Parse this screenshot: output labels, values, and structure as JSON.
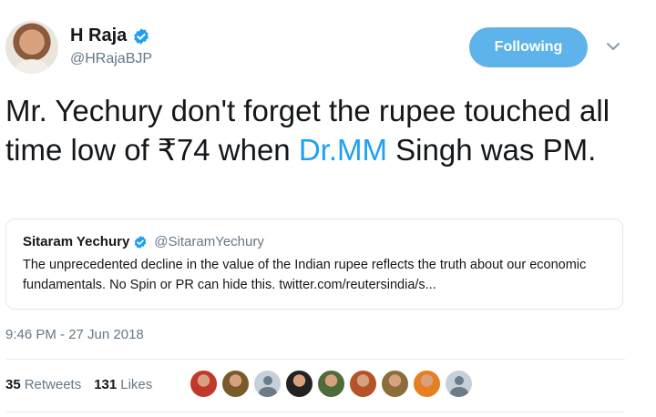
{
  "author": {
    "name": "H Raja",
    "handle": "@HRajaBJP"
  },
  "follow_button": {
    "label": "Following"
  },
  "tweet": {
    "text_before": "Mr. Yechury don't forget the rupee touched all time low of ₹74 when ",
    "mention": "Dr.MM",
    "text_after": " Singh was PM.",
    "timestamp": "9:46 PM - 27 Jun 2018"
  },
  "quoted_tweet": {
    "name": "Sitaram Yechury",
    "handle": "@SitaramYechury",
    "text": "The unprecedented decline in the value of the Indian rupee reflects the truth about our economic fundamentals. No Spin or PR can hide this. twitter.com/reutersindia/s..."
  },
  "stats": {
    "retweets_count": "35",
    "retweets_label": "Retweets",
    "likes_count": "131",
    "likes_label": "Likes"
  },
  "liker_avatars": [
    {
      "color": "#c0392b"
    },
    {
      "color": "#7a5a2a"
    },
    {
      "color": "default"
    },
    {
      "color": "#222222"
    },
    {
      "color": "#4e6b3a"
    },
    {
      "color": "#b5532a"
    },
    {
      "color": "#8a6d3b"
    },
    {
      "color": "#e67e22"
    },
    {
      "color": "default"
    }
  ],
  "colors": {
    "accent": "#1da1f2",
    "follow_button_bg": "#5fb3eb",
    "secondary_text": "#657786"
  }
}
